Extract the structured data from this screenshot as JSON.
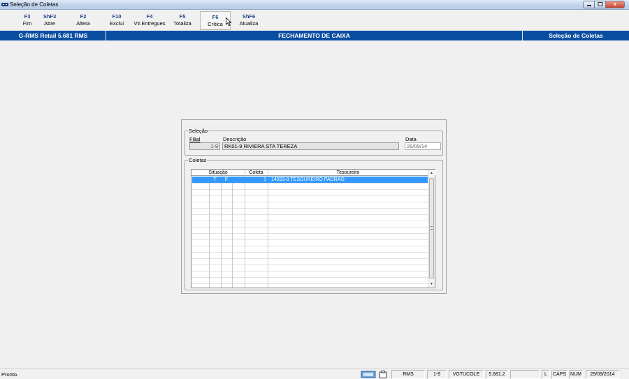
{
  "window": {
    "title": "Seleção de Coletas",
    "close_label": "x"
  },
  "toolbar": {
    "keys": [
      {
        "key": "F3",
        "label": "Fim"
      },
      {
        "key": "ShF3",
        "label": "Abre"
      },
      {
        "key": "F2",
        "label": "Altera"
      },
      {
        "key": "F10",
        "label": "Exclui"
      },
      {
        "key": "F4",
        "label": "Vlr.Entregues"
      },
      {
        "key": "F5",
        "label": "Totaliza"
      },
      {
        "key": "F6",
        "label": "Crítica"
      },
      {
        "key": "ShF6",
        "label": "Atualiza"
      }
    ]
  },
  "header": {
    "app_name": "G-RMS Retail 5.681 RMS",
    "screen_title": "FECHAMENTO DE CAIXA",
    "screen_name": "Seleção de Coletas"
  },
  "selecao": {
    "legend": "Seleção",
    "filial_label": "Filial",
    "filial_value": "1-9",
    "descricao_label": "Descrição",
    "descricao_value": "RK01-9 RIVIERA STA TEREZA",
    "data_label": "Data",
    "data_value": "26/09/14"
  },
  "coletas": {
    "legend": "Coletas",
    "columns": [
      "Situação",
      "Coleta",
      "Tesoureiro"
    ],
    "rows": [
      {
        "sit1": "",
        "sit2": "T",
        "sit3": "F",
        "coleta": "1",
        "tesoureiro": "14593-9 TESOUREIRO PADRAO"
      }
    ]
  },
  "statusbar": {
    "message": "Pronto.",
    "cells": [
      "RMS",
      "1-9",
      "VGTUCOLE",
      "5.681.2",
      "",
      "L",
      "CAPS",
      "NUM",
      "29/09/2014"
    ]
  },
  "colors": {
    "header_blue": "#0a4ea1",
    "fkey_blue": "#1f3f86",
    "selection": "#3399ff"
  }
}
